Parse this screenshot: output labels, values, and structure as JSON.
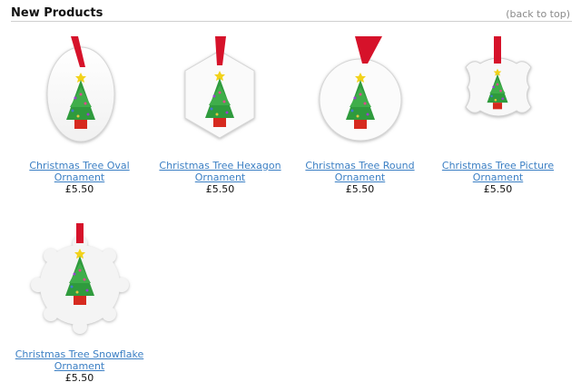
{
  "header": {
    "title": "New Products",
    "back_to_top": "(back to top)"
  },
  "colors": {
    "link": "#3b7fc4",
    "ribbon": "#d6122a",
    "tree": "#2f9b3d",
    "star": "#f2d21a",
    "pot": "#d62a1f"
  },
  "products": [
    {
      "name": "Christmas Tree Oval Ornament",
      "price": "£5.50",
      "shape": "oval"
    },
    {
      "name": "Christmas Tree Hexagon Ornament",
      "price": "£5.50",
      "shape": "hexagon"
    },
    {
      "name": "Christmas Tree Round Ornament",
      "price": "£5.50",
      "shape": "round"
    },
    {
      "name": "Christmas Tree Picture Ornament",
      "price": "£5.50",
      "shape": "picture"
    },
    {
      "name": "Christmas Tree Snowflake Ornament",
      "price": "£5.50",
      "shape": "snowflake"
    }
  ]
}
